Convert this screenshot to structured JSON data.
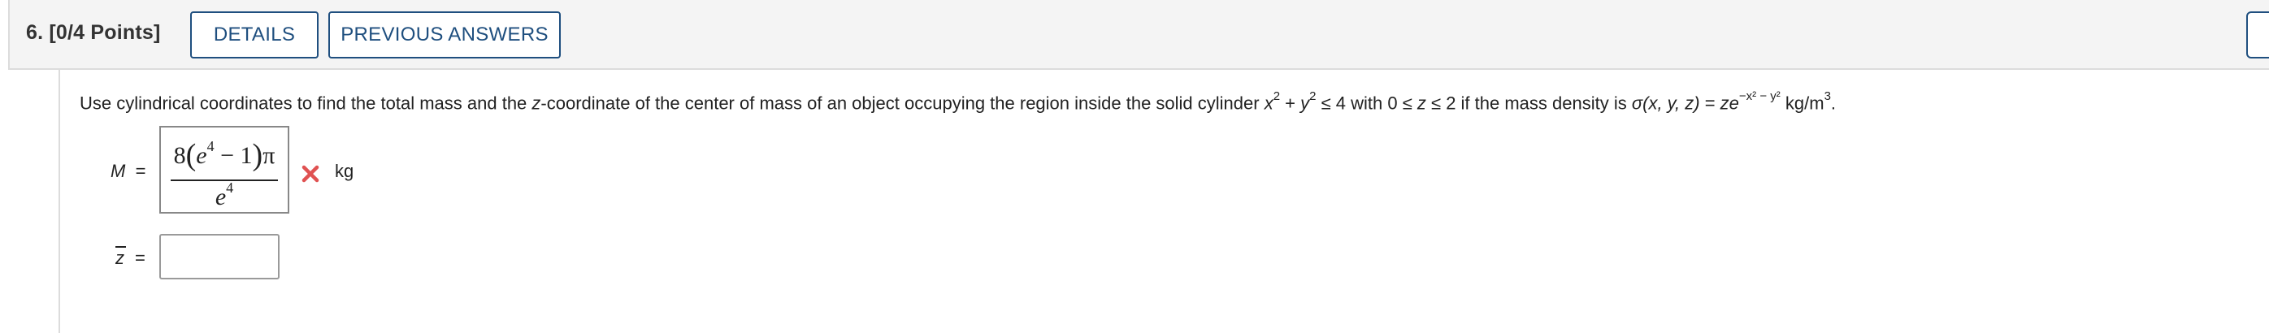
{
  "question": {
    "number_label": "6.",
    "points_label": "[0/4 Points]",
    "details_button": "DETAILS",
    "previous_answers_button": "PREVIOUS ANSWERS"
  },
  "prompt": {
    "part1": "Use cylindrical coordinates to find the total mass and the ",
    "z_var": "z",
    "part2": "-coordinate of the center of mass of an object occupying the region inside the solid cylinder ",
    "x_var": "x",
    "exp2a": "2",
    "plus": " + ",
    "y_var": "y",
    "exp2b": "2",
    "part3": " ≤ 4 with 0 ≤ ",
    "z_var2": "z",
    "part4": " ≤ 2 if the mass density is ",
    "sigma": "σ",
    "args": "(x, y, z)",
    "equals": " = ",
    "ze": "ze",
    "exponent": "−x² − y²",
    "unit": " kg/m",
    "unit_exp": "3",
    "end": "."
  },
  "mass_row": {
    "label": "M",
    "equals": "=",
    "answer_numer_coef": "8",
    "answer_numer_e": "e",
    "answer_numer_exp": "4",
    "answer_numer_rest": " − 1",
    "answer_numer_pi": "π",
    "answer_denom_e": "e",
    "answer_denom_exp": "4",
    "status": "incorrect",
    "status_icon": "x-icon",
    "status_color": "#e05252",
    "unit": "kg"
  },
  "zbar_row": {
    "label": "z",
    "equals": "=",
    "input_value": ""
  },
  "colors": {
    "accent": "#1f4f7f",
    "header_bg": "#f4f4f4",
    "error": "#e05252"
  }
}
